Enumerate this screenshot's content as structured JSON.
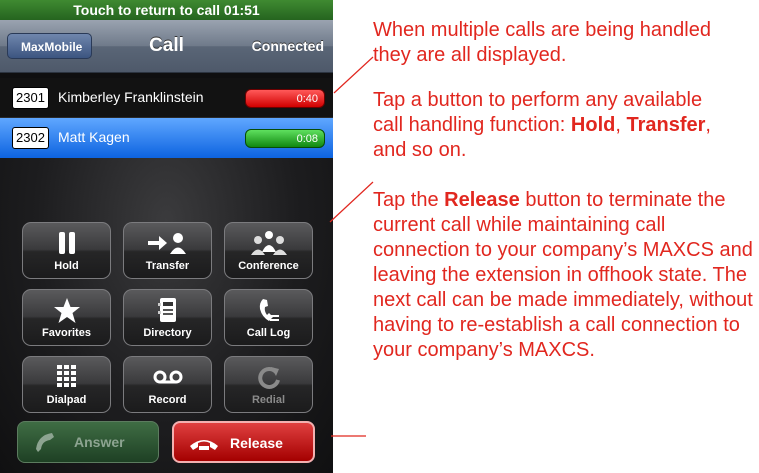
{
  "status_bar": {
    "text": "Touch to return to call  01:51"
  },
  "nav": {
    "back_label": "MaxMobile",
    "title": "Call",
    "status": "Connected"
  },
  "calls": [
    {
      "extension": "2301",
      "name": "Kimberley Franklinstein",
      "timer": "0:40",
      "timer_color": "#e00000",
      "selected": false
    },
    {
      "extension": "2302",
      "name": "Matt Kagen",
      "timer": "0:08",
      "timer_color": "#1a9a1a",
      "selected": true
    }
  ],
  "buttons": [
    {
      "label": "Hold",
      "icon": "pause-icon",
      "enabled": true
    },
    {
      "label": "Transfer",
      "icon": "transfer-icon",
      "enabled": true
    },
    {
      "label": "Conference",
      "icon": "conference-icon",
      "enabled": true
    },
    {
      "label": "Favorites",
      "icon": "star-icon",
      "enabled": true
    },
    {
      "label": "Directory",
      "icon": "directory-icon",
      "enabled": true
    },
    {
      "label": "Call Log",
      "icon": "call-log-icon",
      "enabled": true
    },
    {
      "label": "Dialpad",
      "icon": "dialpad-icon",
      "enabled": true
    },
    {
      "label": "Record",
      "icon": "tape-icon",
      "enabled": true
    },
    {
      "label": "Redial",
      "icon": "redial-icon",
      "enabled": false
    }
  ],
  "answer_button": {
    "label": "Answer",
    "icon": "phone-icon",
    "enabled": false
  },
  "release_button": {
    "label": "Release",
    "icon": "hangup-icon"
  },
  "annotations": {
    "note1": "When multiple calls are being handled they are all displayed.",
    "note2_prefix": "Tap a button to perform any available call handling function:",
    "note2_bold1": "Hold",
    "note2_sep": ",",
    "note2_bold2": "Transfer",
    "note2_suffix": ", and so on.",
    "note3_prefix": "Tap the",
    "note3_bold": "Release",
    "note3_suffix": "button to terminate the current call while maintaining call connection to your company’s MAXCS and leaving the extension in offhook state. The next call can be made immediately, without having to re-establish a call connection to your company’s MAXCS."
  },
  "colors": {
    "annotation": "#e1271f",
    "status_bar": "#2f7a27",
    "selected_row": "#1e73e8"
  }
}
